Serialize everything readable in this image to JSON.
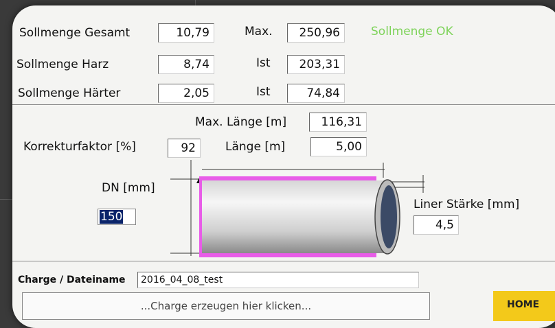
{
  "rows": [
    {
      "label": "Sollmenge Gesamt",
      "value": "10,79",
      "right_label": "Max.",
      "right_value": "250,96"
    },
    {
      "label": "Sollmenge Harz",
      "value": "8,74",
      "right_label": "Ist",
      "right_value": "203,31"
    },
    {
      "label": "Sollmenge Härter",
      "value": "2,05",
      "right_label": "Ist",
      "right_value": "74,84"
    }
  ],
  "status": {
    "text": "Sollmenge OK",
    "color": "#7ed35a"
  },
  "max_length": {
    "label": "Max. Länge [m]",
    "value": "116,31"
  },
  "correction": {
    "label": "Korrekturfaktor [%]",
    "value": "92"
  },
  "length": {
    "label": "Länge [m]",
    "value": "5,00"
  },
  "dn": {
    "label": "DN [mm]",
    "value": "150"
  },
  "liner": {
    "label": "Liner Stärke [mm]",
    "value": "4,5"
  },
  "charge": {
    "label": "Charge / Dateiname",
    "value": "2016_04_08_test"
  },
  "create_button": "...Charge erzeugen hier klicken...",
  "home_button": "HOME",
  "colors": {
    "pipe_liner": "#e85ce8",
    "home": "#f3c91a"
  },
  "icons": [
    "pipe-diagram-icon"
  ]
}
